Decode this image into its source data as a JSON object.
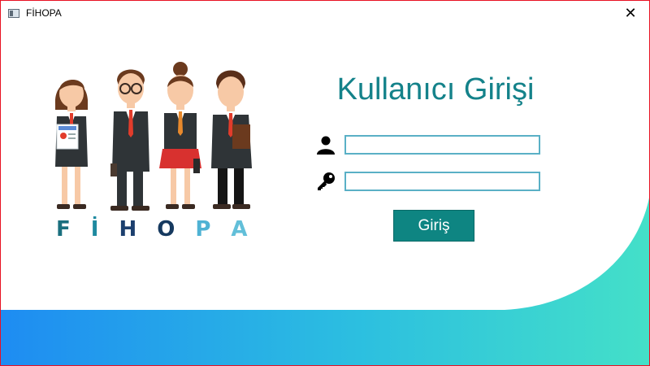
{
  "window": {
    "title": "FİHOPA",
    "close_label": "✕"
  },
  "brand": {
    "letters": [
      "F",
      "İ",
      "H",
      "O",
      "P",
      "A"
    ],
    "colors": [
      "#1a6f7e",
      "#1f8aa0",
      "#1c3f6e",
      "#16395f",
      "#4fb2d4",
      "#62bfd9"
    ]
  },
  "login": {
    "title": "Kullanıcı Girişi",
    "username_value": "",
    "password_value": "",
    "button_label": "Giriş"
  },
  "icons": {
    "user": "user-icon",
    "password": "key-icon"
  },
  "colors": {
    "accent": "#0e8582",
    "gradient_start": "#1e90f0",
    "gradient_end": "#44e0c8",
    "border": "#e81123"
  }
}
